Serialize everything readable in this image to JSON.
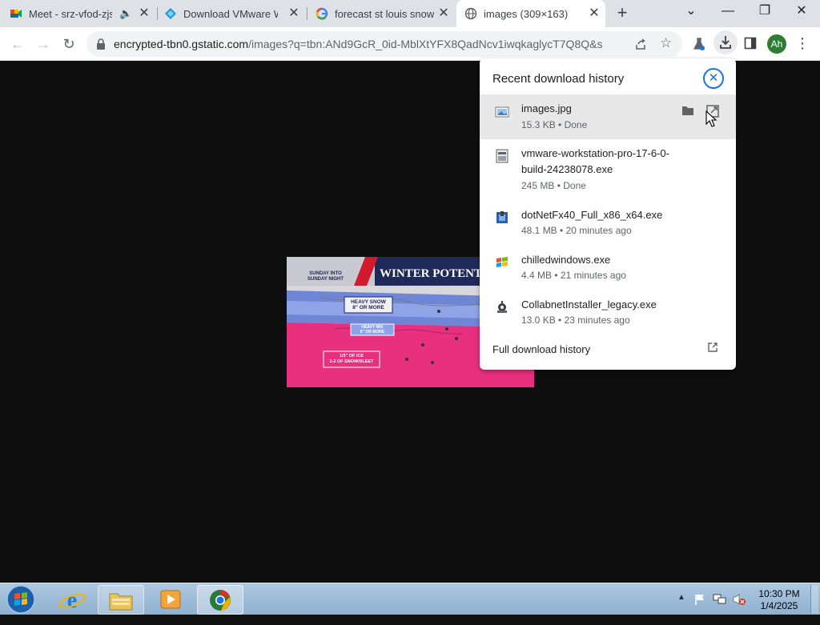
{
  "tabs": [
    {
      "title": "Meet - srz-vfod-zjs",
      "icon": "google-meet-icon"
    },
    {
      "title": "Download VMware Workstation",
      "icon": "vmware-icon"
    },
    {
      "title": "forecast st louis snow",
      "icon": "google-icon"
    },
    {
      "title": "images (309×163)",
      "icon": "globe-icon",
      "active": true
    }
  ],
  "window": {
    "minimize": "—",
    "restore": "❐",
    "close": "✕",
    "tab_search": "⌄",
    "new_tab": "+"
  },
  "address": {
    "domain": "encrypted-tbn0.gstatic.com",
    "path": "/images?q=tbn:ANd9GcR_0id-MblXtYFX8QadNcv1iwqkaglycT7Q8Q&s"
  },
  "profile": {
    "initials": "Ah",
    "color": "#2e7d32"
  },
  "image_overlay": {
    "banner": "WINTER POTENTIAL",
    "subbanner": [
      "SUNDAY INTO",
      "SUNDAY NIGHT"
    ],
    "heavy_snow": [
      "HEAVY SNOW",
      "8\" OR MORE"
    ],
    "heavy_mix": [
      "HEAVY MIX",
      "6\" OR MORE"
    ],
    "ice": [
      "1/3\" OF ICE",
      "1-2 OF SNOW/SLEET"
    ]
  },
  "downloads": {
    "title": "Recent download history",
    "items": [
      {
        "name": "images.jpg",
        "size": "15.3 KB",
        "status": "Done",
        "icon": "image-file-icon"
      },
      {
        "name": "vmware-workstation-pro-17-6-0-build-24238078.exe",
        "name_lines": [
          "vmware-workstation-pro-17-6-0-",
          "build-24238078.exe"
        ],
        "size": "245 MB",
        "status": "Done",
        "icon": "exe-file-icon"
      },
      {
        "name": "dotNetFx40_Full_x86_x64.exe",
        "size": "48.1 MB",
        "status": "20 minutes ago",
        "icon": "installer-icon"
      },
      {
        "name": "chilledwindows.exe",
        "size": "4.4 MB",
        "status": "21 minutes ago",
        "icon": "windows-logo-icon"
      },
      {
        "name": "CollabnetInstaller_legacy.exe",
        "size": "13.0 KB",
        "status": "23 minutes ago",
        "icon": "collabnet-icon"
      }
    ],
    "meta_sep": " • ",
    "full_history": "Full download history"
  },
  "clock": {
    "time": "10:30 PM",
    "date": "1/4/2025"
  }
}
